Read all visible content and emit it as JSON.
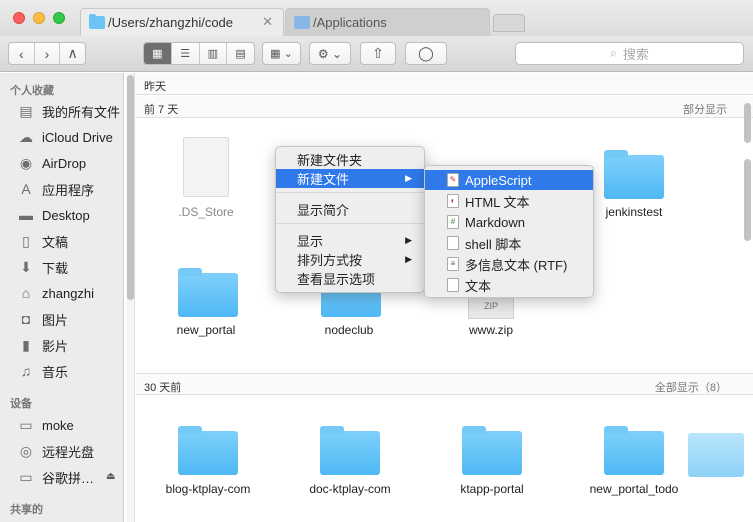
{
  "tabs": [
    {
      "label": "/Users/zhangzhi/code",
      "close": "✕"
    },
    {
      "label": "/Applications",
      "close": ""
    }
  ],
  "toolbar": {
    "back": "‹",
    "forward": "›",
    "up": "∧",
    "views": [
      "▦",
      "☰",
      "▥",
      "▤"
    ],
    "arrange": "▦ ⌄",
    "action": "⚙ ⌄",
    "share": "⇧",
    "tag": "◯",
    "search_placeholder": "搜索",
    "search_icon": "search-icon"
  },
  "sidebar": {
    "favorites_head": "个人收藏",
    "favorites": [
      {
        "label": "我的所有文件",
        "icon": "▤"
      },
      {
        "label": "iCloud Drive",
        "icon": "☁"
      },
      {
        "label": "AirDrop",
        "icon": "◉"
      },
      {
        "label": "应用程序",
        "icon": "A"
      },
      {
        "label": "Desktop",
        "icon": "▬"
      },
      {
        "label": "文稿",
        "icon": "▯"
      },
      {
        "label": "下载",
        "icon": "⬇"
      },
      {
        "label": "zhangzhi",
        "icon": "⌂"
      },
      {
        "label": "图片",
        "icon": "◘"
      },
      {
        "label": "影片",
        "icon": "▮"
      },
      {
        "label": "音乐",
        "icon": "♫"
      }
    ],
    "devices_head": "设备",
    "devices": [
      {
        "label": "moke",
        "icon": "▭"
      },
      {
        "label": "远程光盘",
        "icon": "◎"
      },
      {
        "label": "谷歌拼…",
        "icon": "▭",
        "eject": "⏏"
      }
    ],
    "shared_head": "共享的"
  },
  "main": {
    "sections": [
      {
        "label": "昨天",
        "right": ""
      },
      {
        "label": "前 7 天",
        "right": "部分显示"
      },
      {
        "label": "30 天前",
        "right": "全部显示（8）"
      }
    ],
    "week_items": [
      {
        "name": ".DS_Store",
        "kind": "file"
      },
      {
        "name": "jenkinstest",
        "kind": "folder"
      },
      {
        "name": "new_portal",
        "kind": "folder"
      },
      {
        "name": "nodeclub",
        "kind": "folder"
      },
      {
        "name": "www.zip",
        "kind": "zip",
        "badge": "ZIP"
      }
    ],
    "month_items": [
      {
        "name": "blog-ktplay-com"
      },
      {
        "name": "doc-ktplay-com"
      },
      {
        "name": "ktapp-portal"
      },
      {
        "name": "new_portal_todo"
      }
    ]
  },
  "context_menu": {
    "items": [
      {
        "label": "新建文件夹"
      },
      {
        "label": "新建文件",
        "arrow": "▶"
      },
      {
        "label": "显示简介"
      },
      {
        "label": "显示",
        "arrow": "▶"
      },
      {
        "label": "排列方式按",
        "arrow": "▶"
      },
      {
        "label": "查看显示选项"
      }
    ]
  },
  "submenu": {
    "items": [
      {
        "label": "AppleScript",
        "icon": "✎"
      },
      {
        "label": "HTML 文本",
        "icon": "◐"
      },
      {
        "label": "Markdown",
        "icon": "#"
      },
      {
        "label": "shell 脚本",
        "icon": ""
      },
      {
        "label": "多信息文本 (RTF)",
        "icon": "≡"
      },
      {
        "label": "文本",
        "icon": ""
      }
    ]
  },
  "colors": {
    "accent": "#2f79ea",
    "folder": "#5ebef6"
  }
}
